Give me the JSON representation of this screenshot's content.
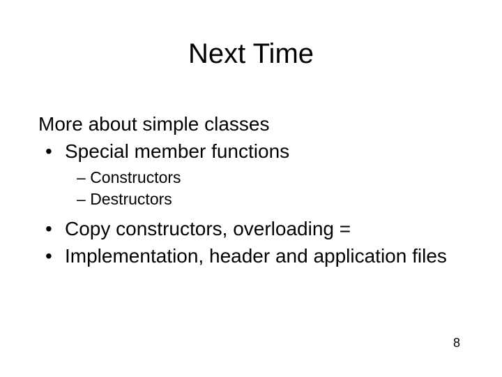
{
  "title": "Next Time",
  "intro": "More about simple classes",
  "bullets": {
    "b1": "Special member functions",
    "b1_sub1": "Constructors",
    "b1_sub2": "Destructors",
    "b2": "Copy constructors, overloading =",
    "b3": "Implementation, header and application files"
  },
  "glyphs": {
    "dot": "•",
    "dash": "–"
  },
  "page_number": "8"
}
